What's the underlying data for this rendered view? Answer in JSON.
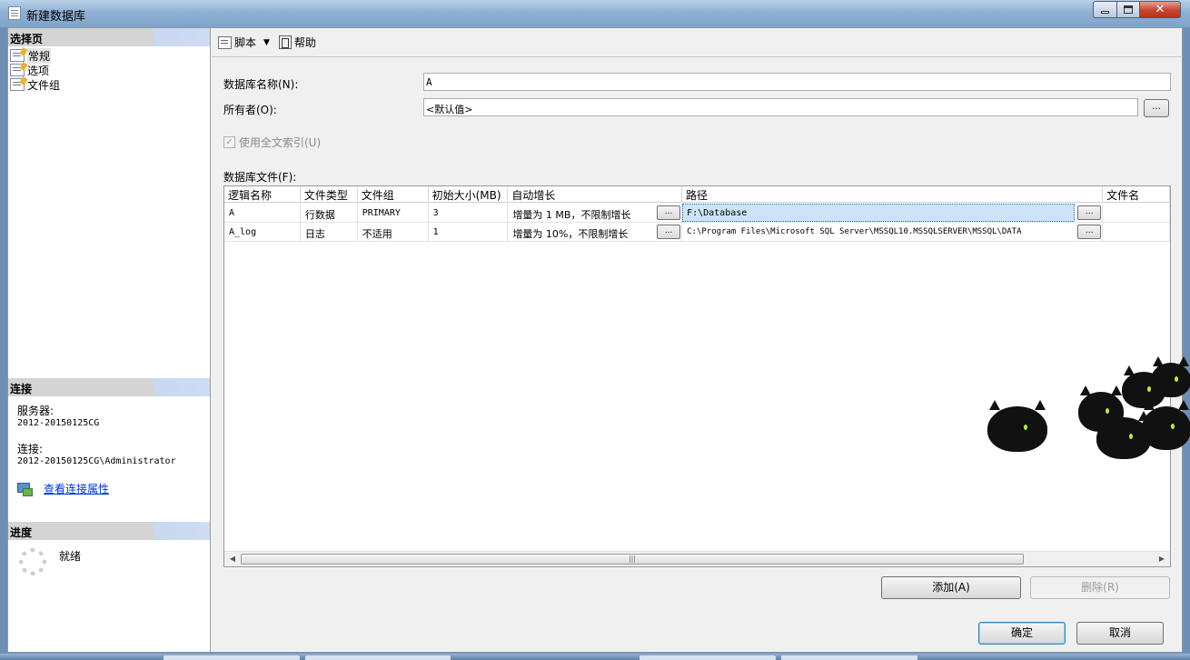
{
  "window": {
    "title": "新建数据库"
  },
  "left": {
    "select_page_header": "选择页",
    "pages": [
      {
        "label": "常规",
        "selected": true
      },
      {
        "label": "选项",
        "selected": false
      },
      {
        "label": "文件组",
        "selected": false
      }
    ],
    "connection_header": "连接",
    "server_label": "服务器:",
    "server_value": "2012-20150125CG",
    "connection_label": "连接:",
    "connection_value": "2012-20150125CG\\Administrator",
    "view_connection_link": "查看连接属性",
    "progress_header": "进度",
    "progress_status": "就绪"
  },
  "toolbar": {
    "script_label": "脚本",
    "help_label": "帮助"
  },
  "form": {
    "db_name_label": "数据库名称(N):",
    "db_name_value": "A",
    "owner_label": "所有者(O):",
    "owner_value": "<默认值>",
    "owner_browse": "...",
    "fulltext_label": "使用全文索引(U)",
    "fulltext_checked": true,
    "files_label": "数据库文件(F):"
  },
  "grid": {
    "columns": [
      "逻辑名称",
      "文件类型",
      "文件组",
      "初始大小(MB)",
      "自动增长",
      "路径",
      "文件名"
    ],
    "rows": [
      {
        "logical_name": "A",
        "file_type": "行数据",
        "filegroup": "PRIMARY",
        "initial_size": "3",
        "autogrowth": "增量为 1 MB，不限制增长",
        "path": "F:\\Database",
        "file_name": ""
      },
      {
        "logical_name": "A_log",
        "file_type": "日志",
        "filegroup": "不适用",
        "initial_size": "1",
        "autogrowth": "增量为 10%，不限制增长",
        "path": "C:\\Program Files\\Microsoft SQL Server\\MSSQL10.MSSQLSERVER\\MSSQL\\DATA",
        "file_name": ""
      }
    ],
    "cell_button": "..."
  },
  "buttons": {
    "add": "添加(A)",
    "remove": "删除(R)",
    "ok": "确定",
    "cancel": "取消"
  },
  "colors": {
    "section_header": "#d4d4d4",
    "selected_path_cell": "#cce4f7",
    "link": "#0033cc",
    "close_button": "#c8442a"
  }
}
